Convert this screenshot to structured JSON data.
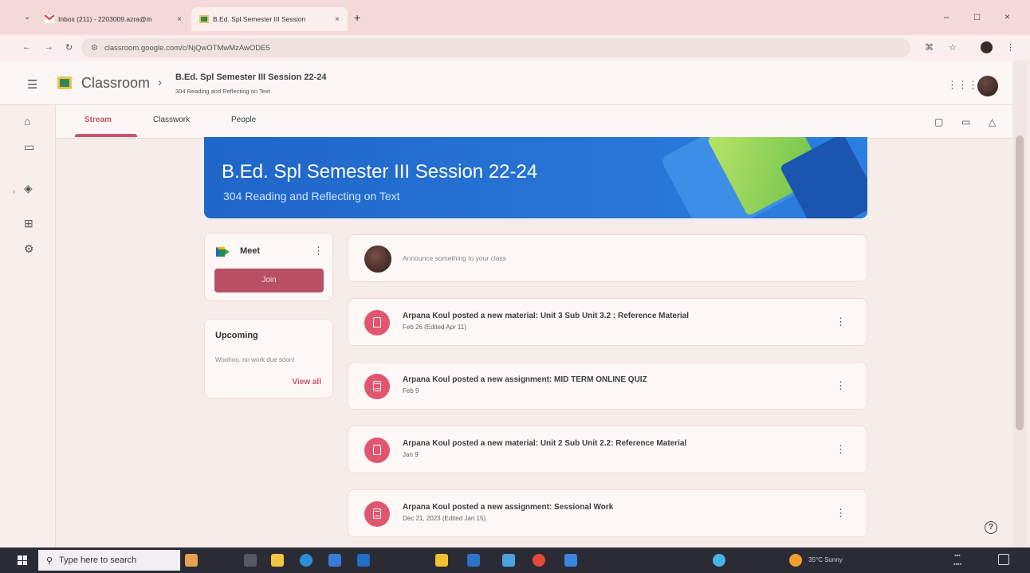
{
  "browser": {
    "tabs": [
      {
        "title": "Inbox (211) - 2203009.azra@m",
        "favicon": "gmail-icon",
        "close": "×"
      },
      {
        "title": "B.Ed. Spl Semester III Session",
        "favicon": "classroom-icon",
        "close": "×"
      }
    ],
    "new_tab": "+",
    "url": "classroom.google.com/c/NjQwOTMwMzAwODE5",
    "window_controls": {
      "minimize": "–",
      "maximize": "□",
      "close": "×"
    }
  },
  "app": {
    "name": "Classroom",
    "breadcrumb": {
      "title": "B.Ed. Spl Semester III Session 22-24",
      "subtitle": "304 Reading and Reflecting on Text"
    }
  },
  "tabs": {
    "stream": "Stream",
    "classwork": "Classwork",
    "people": "People"
  },
  "banner": {
    "title": "B.Ed. Spl Semester III Session 22-24",
    "subtitle": "304 Reading and Reflecting on Text",
    "color": "#2a74d8"
  },
  "meet": {
    "label": "Meet",
    "join": "Join"
  },
  "upcoming": {
    "title": "Upcoming",
    "note": "Woohoo, no work due soon!",
    "view_all": "View all"
  },
  "announce": {
    "placeholder": "Announce something to your class"
  },
  "posts": [
    {
      "title": "Arpana Koul posted a new material: Unit 3 Sub Unit 3.2 : Reference Material",
      "date": "Feb 26 (Edited Apr 11)",
      "kind": "material"
    },
    {
      "title": "Arpana Koul posted a new assignment: MID TERM ONLINE QUIZ",
      "date": "Feb 9",
      "kind": "assignment"
    },
    {
      "title": "Arpana Koul posted a new material: Unit 2 Sub Unit 2.2: Reference Material",
      "date": "Jan 9",
      "kind": "material"
    },
    {
      "title": "Arpana Koul posted a new assignment: Sessional Work",
      "date": "Dec 21, 2023 (Edited Jan 15)",
      "kind": "assignment"
    }
  ],
  "taskbar": {
    "search_placeholder": "Type here to search",
    "weather": "35°C Sunny"
  },
  "colors": {
    "accent": "#c2566b",
    "join_button": "#b84f64",
    "post_icon": "#e0566f",
    "banner": "#2a74d8"
  }
}
